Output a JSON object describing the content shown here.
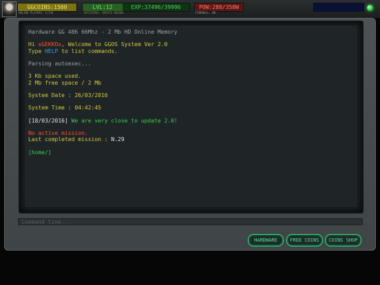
{
  "header": {
    "coins": "GGCOINS:1500",
    "level": "LVL:12",
    "exp": "EXP:37496/39996",
    "pow": "POW:280/350W",
    "sub_online": "ONLINE PLAYERS: 1/134",
    "sub_update": "ANTIVIRUS: UPDATE NEEDED",
    "sub_firewall": "FIREWALL: ON"
  },
  "terminal": {
    "hardware_line": "Hardware GG 486 66Mhz - 2 Mb HD Online Memory",
    "hi_prefix": "Hi ",
    "username": "xGEKKOx",
    "welcome_suffix": ", Welcome to GGOS System Ver 2.0",
    "type_prefix": "Type ",
    "help_cmd": "HELP",
    "type_suffix": " to list commands.",
    "parsing": "Parsing autoexec...",
    "space_used": "3 Kb space used.",
    "free_space": "2 Mb free space / 2 Mb",
    "system_date_label": "System Date : ",
    "system_date": "26/03/2016",
    "system_time_label": "System Time : ",
    "system_time": "04:42:45",
    "news_date": "[18/03/2016]",
    "news_text": " We are very close to update 2.0!",
    "no_mission": "No active mission.",
    "last_mission_label": "Last completed mission : ",
    "last_mission": "N.29",
    "prompt": "[home/]"
  },
  "command_line": {
    "placeholder": "Command line..."
  },
  "buttons": {
    "hardware": "HARDWARE",
    "free_coins": "FREE COINS",
    "coins_shop": "COINS SHOP"
  },
  "colors": {
    "terminal_bg": "#1f2427",
    "accent_green": "#57e59a",
    "yellow_text": "#d6cd3e",
    "red_text": "#ff5533",
    "blue_text": "#3a9de6",
    "green_text": "#39d14c"
  }
}
